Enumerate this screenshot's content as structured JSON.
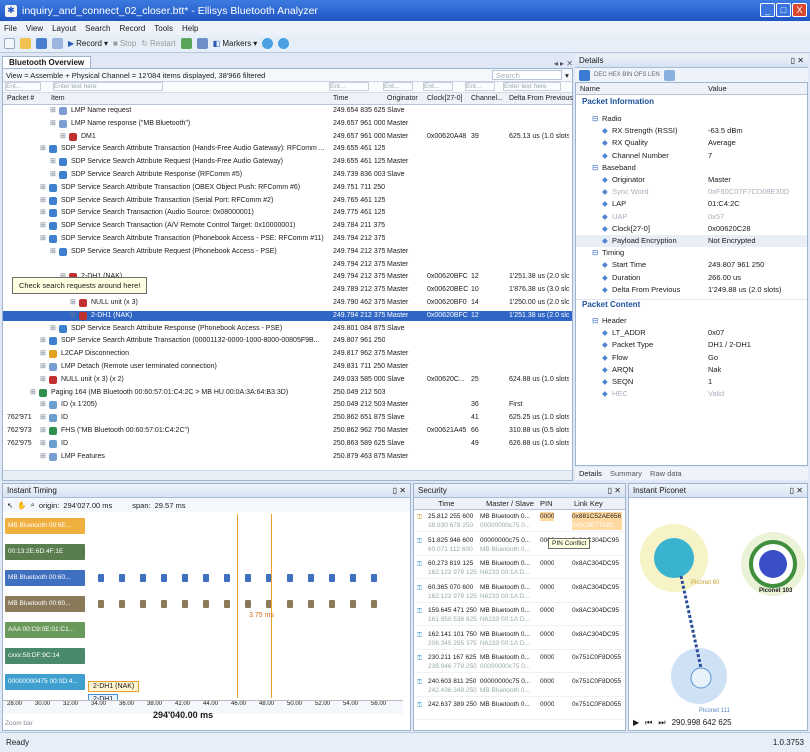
{
  "window": {
    "title": "inquiry_and_connect_02_closer.btt* - Ellisys Bluetooth Analyzer",
    "min": "_",
    "max": "□",
    "close": "X"
  },
  "menu": [
    "File",
    "View",
    "Layout",
    "Search",
    "Record",
    "Tools",
    "Help"
  ],
  "toolbar": {
    "record": "Record",
    "stop": "Stop",
    "restart": "Restart",
    "markers": "Markers"
  },
  "overview": {
    "tab": "Bluetooth Overview",
    "filter_bar": "View = Assemble + Physical Channel = 12'084 items displayed, 38'966 filtered",
    "search_placeholder": "Search",
    "filter_hint": "Enter text here",
    "filter_short": "Ent...",
    "columns": [
      "Packet #",
      "Item",
      "Time",
      "Originator",
      "Clock[27-0]",
      "Channel...",
      "Delta From Previous"
    ],
    "rows": [
      {
        "pkt": "",
        "item": "LMP Name request",
        "time": "249.654 835 625",
        "orig": "Slave",
        "clock": "",
        "chan": "",
        "delta": "",
        "indent": 3,
        "color": "#7a9ed4"
      },
      {
        "pkt": "",
        "item": "LMP Name response (\"MB Bluetooth\")",
        "time": "249.657 961 000",
        "orig": "Master",
        "clock": "",
        "chan": "",
        "delta": "",
        "indent": 3,
        "color": "#7a9ed4"
      },
      {
        "pkt": "",
        "item": "DM1",
        "time": "249.657 961 000",
        "orig": "Master",
        "clock": "0x00620A48",
        "chan": "39",
        "delta": "625.13 us (1.0 slots",
        "indent": 4,
        "color": "#c03030"
      },
      {
        "pkt": "",
        "item": "SDP Service Search Attribute Transaction (Hands-Free Audio Gateway): RFComm ...",
        "time": "249.655 461 125",
        "orig": "",
        "clock": "",
        "chan": "",
        "delta": "",
        "indent": 2,
        "color": "#3f7fcf"
      },
      {
        "pkt": "",
        "item": "SDP Service Search Attribute Request (Hands-Free Audio Gateway)",
        "time": "249.655 461 125",
        "orig": "Master",
        "clock": "",
        "chan": "",
        "delta": "",
        "indent": 3,
        "color": "#3f7fcf"
      },
      {
        "pkt": "",
        "item": "SDP Service Search Attribute Response (RFComm #5)",
        "time": "249.739 836 003",
        "orig": "Slave",
        "clock": "",
        "chan": "",
        "delta": "",
        "indent": 3,
        "color": "#3f7fcf"
      },
      {
        "pkt": "",
        "item": "SDP Service Search Attribute Transaction (OBEX Object Push: RFComm #6)",
        "time": "249.751 711 250",
        "orig": "",
        "clock": "",
        "chan": "",
        "delta": "",
        "indent": 2,
        "color": "#3f7fcf"
      },
      {
        "pkt": "",
        "item": "SDP Service Search Attribute Transaction (Serial Port: RFComm #2)",
        "time": "249.765 461 125",
        "orig": "",
        "clock": "",
        "chan": "",
        "delta": "",
        "indent": 2,
        "color": "#3f7fcf"
      },
      {
        "pkt": "",
        "item": "SDP Service Search Transaction (Audio Source: 0x08000001)",
        "time": "249.775 461 125",
        "orig": "",
        "clock": "",
        "chan": "",
        "delta": "",
        "indent": 2,
        "color": "#3f7fcf"
      },
      {
        "pkt": "",
        "item": "SDP Service Search Transaction (A/V Remote Control Target: 0x10000001)",
        "time": "249.784 211 375",
        "orig": "",
        "clock": "",
        "chan": "",
        "delta": "",
        "indent": 2,
        "color": "#3f7fcf"
      },
      {
        "pkt": "",
        "item": "SDP Service Search Attribute Transaction (Phonebook Access - PSE: RFComm #11)",
        "time": "249.794 212 375",
        "orig": "",
        "clock": "",
        "chan": "",
        "delta": "",
        "indent": 2,
        "color": "#3f7fcf"
      },
      {
        "pkt": "",
        "item": "SDP Service Search Attribute Request (Phonebook Access - PSE)",
        "time": "249.794 212 375",
        "orig": "Master",
        "clock": "",
        "chan": "",
        "delta": "",
        "indent": 3,
        "color": "#3f7fcf"
      },
      {
        "pkt": "",
        "item": "",
        "time": "249.794 212 375",
        "orig": "Master",
        "clock": "",
        "chan": "",
        "delta": "",
        "indent": 3,
        "color": ""
      },
      {
        "pkt": "",
        "item": "2-DH1 (NAK)",
        "time": "249.794 212 375",
        "orig": "Master",
        "clock": "0x00620BFC",
        "chan": "12",
        "delta": "1'251.38 us (2.0 slot",
        "indent": 4,
        "color": "#c03030"
      },
      {
        "pkt": "",
        "item": "NULL unit",
        "time": "249.789 212 375",
        "orig": "Master",
        "clock": "0x00620BEC",
        "chan": "10",
        "delta": "1'876.38 us (3.0 slot",
        "indent": 5,
        "color": "#c03030"
      },
      {
        "pkt": "",
        "item": "NULL unit (x 3)",
        "time": "249.790 462 375",
        "orig": "Master",
        "clock": "0x00620BF0",
        "chan": "14",
        "delta": "1'250.00 us (2.0 slot",
        "indent": 5,
        "color": "#c03030"
      },
      {
        "pkt": "",
        "item": "2-DH1 (NAK)",
        "time": "249.794 212 375",
        "orig": "Master",
        "clock": "0x00620BFC",
        "chan": "12",
        "delta": "1'251.38 us (2.0 slot",
        "indent": 5,
        "color": "#c03030",
        "selected": true
      },
      {
        "pkt": "",
        "item": "SDP Service Search Attribute Response (Phonebook Access - PSE)",
        "time": "249.801 084 875",
        "orig": "Slave",
        "clock": "",
        "chan": "",
        "delta": "",
        "indent": 3,
        "color": "#3f7fcf"
      },
      {
        "pkt": "",
        "item": "SDP Service Search Attribute Transaction (00001132-0000-1000-8000-00805F9B...",
        "time": "249.807 961 250",
        "orig": "",
        "clock": "",
        "chan": "",
        "delta": "",
        "indent": 2,
        "color": "#3f7fcf"
      },
      {
        "pkt": "",
        "item": "L2CAP Disconnection",
        "time": "249.817 962 375",
        "orig": "Master",
        "clock": "",
        "chan": "",
        "delta": "",
        "indent": 2,
        "color": "#e0a020"
      },
      {
        "pkt": "",
        "item": "LMP Detach (Remote user terminated connection)",
        "time": "249.831 711 250",
        "orig": "Master",
        "clock": "",
        "chan": "",
        "delta": "",
        "indent": 2,
        "color": "#7a9ed4"
      },
      {
        "pkt": "",
        "item": "NULL unit (x 3) (x 2)",
        "time": "249.033 585 000",
        "orig": "Slave",
        "clock": "0x00620C...",
        "chan": "25",
        "delta": "624.88 us (1.0 slots",
        "indent": 2,
        "color": "#c03030"
      },
      {
        "pkt": "",
        "item": "Paging 164 (MB Bluetooth 00:60:57:01:C4:2C > MB HU 00:0A:3A:64:B3:3D)",
        "time": "250.049 212 503",
        "orig": "",
        "clock": "",
        "chan": "",
        "delta": "",
        "indent": 1,
        "color": "#2f8f4f"
      },
      {
        "pkt": "",
        "item": "ID (x 1'205)",
        "time": "250.049 212 503",
        "orig": "Master",
        "clock": "",
        "chan": "36",
        "delta": "First",
        "indent": 2,
        "color": "#6aa0d0"
      },
      {
        "pkt": "762'971",
        "item": "ID",
        "time": "250.862 651 875",
        "orig": "Slave",
        "clock": "",
        "chan": "41",
        "delta": "625.25 us (1.0 slots",
        "indent": 2,
        "color": "#6aa0d0"
      },
      {
        "pkt": "762'973",
        "item": "FHS (\"MB Bluetooth 00:60:57:01:C4:2C\")",
        "time": "250.862 962 750",
        "orig": "Master",
        "clock": "0x00621A45",
        "chan": "66",
        "delta": "310.88 us (0.5 slots",
        "indent": 2,
        "color": "#2f8f4f"
      },
      {
        "pkt": "762'975",
        "item": "ID",
        "time": "250.863 589 625",
        "orig": "Slave",
        "clock": "",
        "chan": "49",
        "delta": "626.88 us (1.0 slots",
        "indent": 2,
        "color": "#6aa0d0"
      },
      {
        "pkt": "",
        "item": "LMP Features",
        "time": "250.879 463 875",
        "orig": "Master",
        "clock": "",
        "chan": "",
        "delta": "",
        "indent": 2,
        "color": "#7a9ed4"
      }
    ],
    "callout": "Check search requests around here!"
  },
  "details": {
    "title": "Details",
    "col_name": "Name",
    "col_value": "Value",
    "section1": "Packet Information",
    "section2": "Packet Content",
    "rows": [
      {
        "name": "Radio",
        "value": "",
        "indent": 1,
        "group": true
      },
      {
        "name": "RX Strength (RSSI)",
        "value": "-63.5 dBm",
        "indent": 2
      },
      {
        "name": "RX Quality",
        "value": "Average",
        "indent": 2
      },
      {
        "name": "Channel Number",
        "value": "7",
        "indent": 2
      },
      {
        "name": "Baseband",
        "value": "",
        "indent": 1,
        "group": true
      },
      {
        "name": "Originator",
        "value": "Master",
        "indent": 2
      },
      {
        "name": "Sync Word",
        "value": "0xF60C07F7CD08E30D",
        "indent": 2,
        "muted": true
      },
      {
        "name": "LAP",
        "value": "01:C4:2C",
        "indent": 2
      },
      {
        "name": "UAP",
        "value": "0x57",
        "indent": 2,
        "muted": true
      },
      {
        "name": "Clock[27-0]",
        "value": "0x00620C28",
        "indent": 2
      },
      {
        "name": "Payload Encryption",
        "value": "Not Encrypted",
        "indent": 2,
        "highlight": true
      },
      {
        "name": "Timing",
        "value": "",
        "indent": 1,
        "group": true
      },
      {
        "name": "Start Time",
        "value": "249.807 961 250",
        "indent": 2
      },
      {
        "name": "Duration",
        "value": "266.00 us",
        "indent": 2
      },
      {
        "name": "Delta From Previous",
        "value": "1'249.88 us (2.0 slots)",
        "indent": 2
      }
    ],
    "rows2": [
      {
        "name": "Header",
        "value": "",
        "indent": 1,
        "group": true
      },
      {
        "name": "LT_ADDR",
        "value": "0x07",
        "indent": 2
      },
      {
        "name": "Packet Type",
        "value": "DH1 / 2-DH1",
        "indent": 2
      },
      {
        "name": "Flow",
        "value": "Go",
        "indent": 2
      },
      {
        "name": "ARQN",
        "value": "Nak",
        "indent": 2
      },
      {
        "name": "SEQN",
        "value": "1",
        "indent": 2
      },
      {
        "name": "HEC",
        "value": "Valid",
        "indent": 2,
        "muted": true
      }
    ],
    "tabs": [
      "Details",
      "Summary",
      "Raw data"
    ]
  },
  "timing": {
    "title": "Instant Timing",
    "origin_label": "origin:",
    "origin": "294'027.00 ms",
    "span_label": "span:",
    "span": "29.57 ms",
    "lanes": [
      {
        "label": "MB Bluetooth 00:6E...",
        "color": "#f0b040"
      },
      {
        "label": "00:13:2E:6D:4F:1E",
        "color": "#5a7d50"
      },
      {
        "label": "MB Bluetooth 00:60...",
        "color": "#3f6fbf"
      },
      {
        "label": "MB Bluetooth 00:60...",
        "color": "#8a7a5a"
      },
      {
        "label": "AAA 00:C9:0E:01:C1...",
        "color": "#6a9a5a"
      },
      {
        "label": "cxxx:58:DF:9C:14",
        "color": "#4a8a6a"
      },
      {
        "label": "00000000475 00:0D:4...",
        "color": "#3fa0d0"
      }
    ],
    "marker": "3.75 ms",
    "popup1": "2-DH1 (NAK)",
    "popup2": "2-DH1",
    "ticks": [
      "28.00",
      "30.00",
      "32.00",
      "34.00",
      "36.00",
      "38.00",
      "42.00",
      "44.00",
      "46.00",
      "48.00",
      "50.00",
      "52.00",
      "54.00",
      "56.00"
    ],
    "cursor": "294'040.00 ms",
    "zoom_bar": "Zoom bar"
  },
  "security": {
    "title": "Security",
    "columns": [
      "Time",
      "Master / Slave",
      "PIN",
      "Link Key"
    ],
    "tooltip": "PIN Conflict",
    "rows": [
      {
        "t1": "25.812 255 600",
        "t2": "38.930 678 250",
        "m1": "MB Bluetooth 0...",
        "m2": "00000000c75 0...",
        "pin": "0000",
        "key": "0x881C52AE656",
        "key2": "0x5C8E77A81",
        "highlight": true
      },
      {
        "t1": "51.825 946 600",
        "t2": "60.071 112 600",
        "m1": "00000000c75 0...",
        "m2": "MB Bluetooth 0...",
        "pin": "0000",
        "key": "0x8AC304DC95",
        "key2": ""
      },
      {
        "t1": "60.273 819 125",
        "t2": "162.122 978 125",
        "m1": "MB Bluetooth 0...",
        "m2": "N6233 00:1A:D...",
        "pin": "0000",
        "key": "0x8AC304DC95",
        "key2": ""
      },
      {
        "t1": "60.365 070 600",
        "t2": "162.122 978 125",
        "m1": "MB Bluetooth 0...",
        "m2": "N6233 00:1A:D...",
        "pin": "0000",
        "key": "0x8AC304DC95",
        "key2": ""
      },
      {
        "t1": "159.645 471 250",
        "t2": "161.950 536 625",
        "m1": "MB Bluetooth 0...",
        "m2": "N6233 00:1A:D...",
        "pin": "0000",
        "key": "0x8AC304DC95",
        "key2": ""
      },
      {
        "t1": "162.141 101 750",
        "t2": "206.345 295 375",
        "m1": "MB Bluetooth 0...",
        "m2": "N6233 00:1A:D...",
        "pin": "0000",
        "key": "0x8AC304DC95",
        "key2": ""
      },
      {
        "t1": "230.211 167 625",
        "t2": "238.946 778 250",
        "m1": "MB Bluetooth 0...",
        "m2": "00000000c75 0...",
        "pin": "0000",
        "key": "0x751C0F8D055",
        "key2": ""
      },
      {
        "t1": "240.603 811 250",
        "t2": "242.436 349 250",
        "m1": "00000000c75 0...",
        "m2": "MB Bluetooth 0...",
        "pin": "0000",
        "key": "0x751C0F8D055",
        "key2": ""
      },
      {
        "t1": "242.637 389 250",
        "t2": "",
        "m1": "MB Bluetooth 0...",
        "m2": "",
        "pin": "0000",
        "key": "0x751C0F8D055",
        "key2": ""
      }
    ]
  },
  "piconet": {
    "title": "Instant Piconet",
    "node1": "Piconet 103",
    "node2": "Piconet 111",
    "node3": "Piconet 60",
    "time": "290.998 642 625"
  },
  "status": {
    "left": "Ready",
    "right": "1.0.3753"
  }
}
